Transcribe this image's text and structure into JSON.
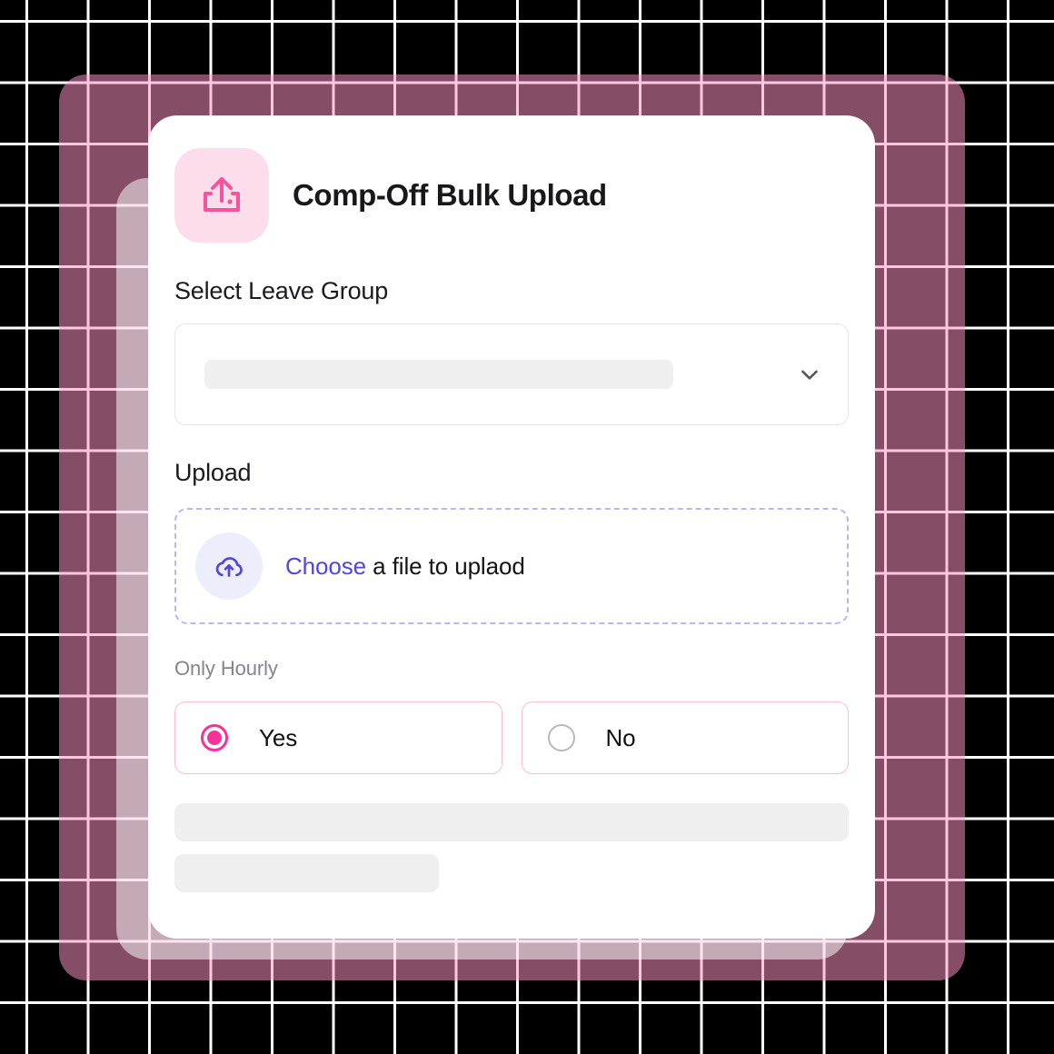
{
  "app": {
    "title": "Comp-Off Bulk Upload",
    "icon": "upload-box-icon",
    "accent_pink": "#F6329A",
    "accent_indigo": "#4F46E5",
    "icon_tile_bg": "#FDDDEB",
    "card_bg": "#FFFFFF",
    "backdrop_bg": "#000000",
    "grid_line_color": "#FFFFFF"
  },
  "leave_group": {
    "label": "Select Leave Group",
    "value": "",
    "placeholder": "",
    "chevron_icon": "chevron-down-icon"
  },
  "upload": {
    "label": "Upload",
    "icon": "cloud-upload-icon",
    "cta": "Choose",
    "cta_suffix": " a file to uplaod"
  },
  "only_hourly": {
    "label": "Only Hourly",
    "selected": "Yes",
    "options": [
      {
        "label": "Yes",
        "selected": true
      },
      {
        "label": "No",
        "selected": false
      }
    ]
  },
  "skeletons": {
    "select_bar": "",
    "footer_bar_wide": "",
    "footer_bar_narrow": ""
  }
}
